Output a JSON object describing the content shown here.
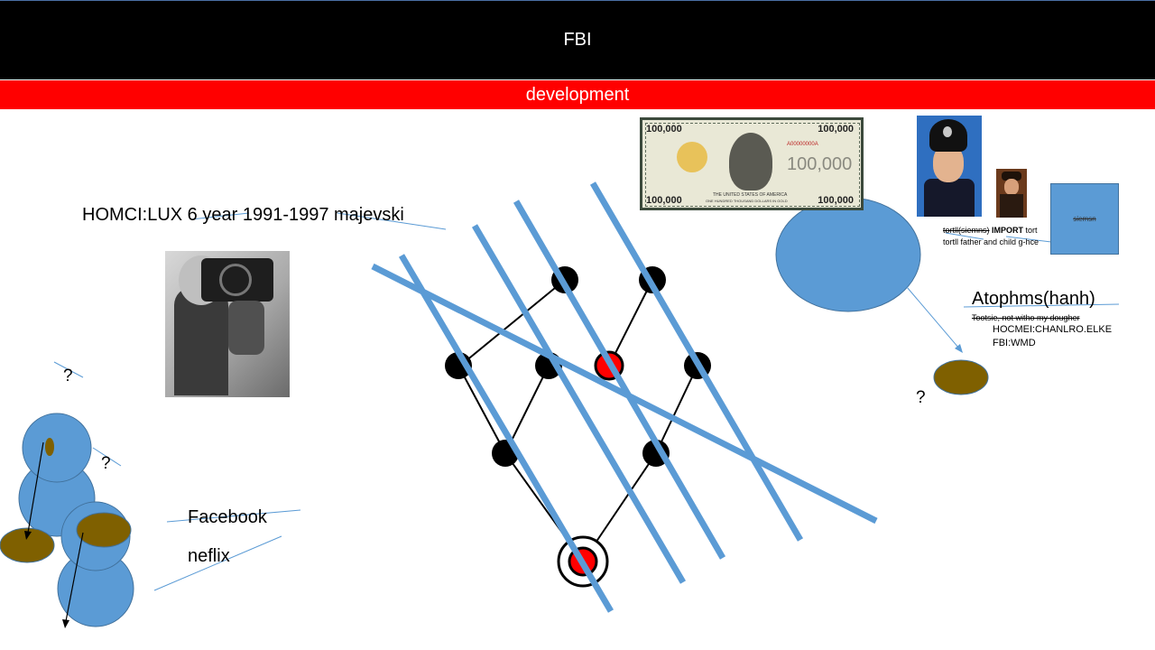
{
  "header": {
    "title": "FBI",
    "subtitle": "development"
  },
  "texts": {
    "homci": "HOMCI:LUX 6 year 1991-1997 majevski",
    "q1": "?",
    "q2": "?",
    "q3": "?",
    "facebook": "Facebook",
    "neflix": "neflix",
    "atophms": "Atophms(hanh)",
    "tootsie": "Tootsie, not witho my dougher",
    "hocmei": "HOCMEI:CHANLRO.ELKE",
    "fbiwmd": "FBI:WMD",
    "tortll1_a": "tortll(siemns)",
    "tortll1_b": "IMPORT",
    "tortll1_c": "tort",
    "tortll2": "tortll father and child g-hce",
    "siemsn": "siemsn"
  },
  "banknote": {
    "corner": "100,000",
    "center": "100,000",
    "serial": "A00000000A",
    "spec": "SPECIMEN",
    "band": "THE UNITED STATES OF AMERICA",
    "bottom": "ONE HUNDRED THOUSAND DOLLARS IN GOLD"
  },
  "colors": {
    "header_bg": "#000000",
    "subheader_bg": "#ff0000",
    "shape_blue": "#5b9bd5",
    "shape_olive": "#7f6000",
    "node_red": "#ff0000",
    "node_black": "#000000"
  }
}
